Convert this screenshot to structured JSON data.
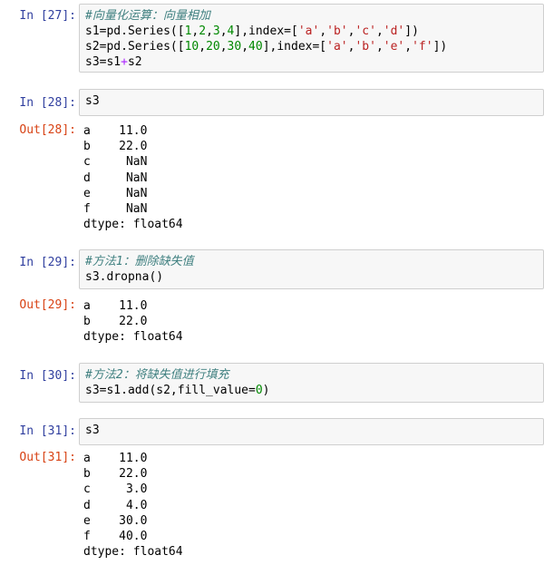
{
  "cells": {
    "c27": {
      "prompt": "In [27]:",
      "lines": [
        "#向量化运算：向量相加",
        "s1=pd.Series([1,2,3,4],index=['a','b','c','d'])",
        "s2=pd.Series([10,20,30,40],index=['a','b','e','f'])",
        "s3=s1+s2"
      ]
    },
    "c28": {
      "prompt": "In [28]:",
      "code": "s3",
      "out_prompt": "Out[28]:",
      "out": [
        "a    11.0",
        "b    22.0",
        "c     NaN",
        "d     NaN",
        "e     NaN",
        "f     NaN",
        "dtype: float64"
      ]
    },
    "c29": {
      "prompt": "In [29]:",
      "lines": [
        "#方法1：删除缺失值",
        "s3.dropna()"
      ],
      "out_prompt": "Out[29]:",
      "out": [
        "a    11.0",
        "b    22.0",
        "dtype: float64"
      ]
    },
    "c30": {
      "prompt": "In [30]:",
      "lines": [
        "#方法2：将缺失值进行填充",
        "s3=s1.add(s2,fill_value=0)"
      ]
    },
    "c31": {
      "prompt": "In [31]:",
      "code": "s3",
      "out_prompt": "Out[31]:",
      "out": [
        "a    11.0",
        "b    22.0",
        "c     3.0",
        "d     4.0",
        "e    30.0",
        "f    40.0",
        "dtype: float64"
      ]
    }
  },
  "colors": {
    "in_prompt": "#303f9f",
    "out_prompt": "#d84315",
    "comment": "#408080",
    "number": "#008800",
    "string": "#ba2121",
    "operator": "#aa22ff"
  }
}
